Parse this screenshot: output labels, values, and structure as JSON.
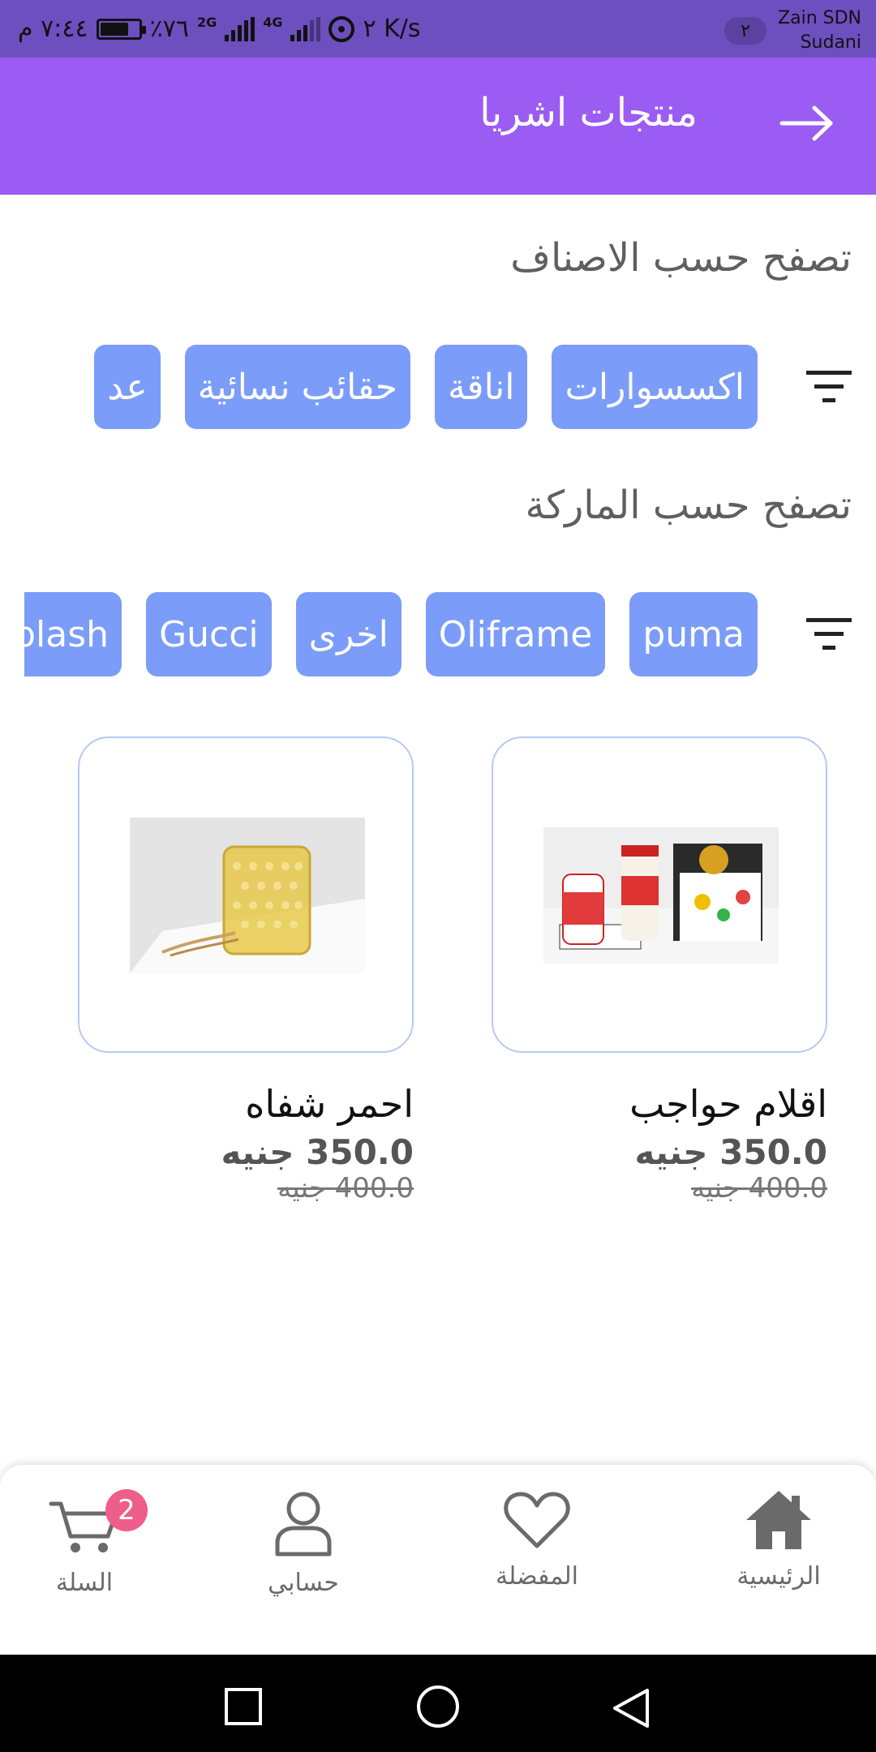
{
  "status_bar": {
    "time": "٧:٤٤ م",
    "battery_text": "٪٧٦",
    "battery_level_percent": 76,
    "net_2g": "2G",
    "net_4g": "4G",
    "speed": "٢ K/s",
    "sim_badge": "٢",
    "carrier_line1": "Zain SDN",
    "carrier_line2": "Sudani"
  },
  "app_bar": {
    "title": "منتجات اشريا",
    "back_icon": "arrow-right-icon"
  },
  "categories": {
    "title": "تصفح حسب الاصناف",
    "filter_icon": "filter-icon",
    "chips": [
      "اكسسوارات",
      "اناقة",
      "حقائب نسائية",
      "عد"
    ]
  },
  "brands": {
    "title": "تصفح حسب الماركة",
    "filter_icon": "filter-icon",
    "chips": [
      "puma",
      "Oliframe",
      "اخرى",
      "Gucci",
      "plash"
    ]
  },
  "products": [
    {
      "name": "اقلام حواجب",
      "price": "350.0 جنيه",
      "old_price": "400.0 جنيه"
    },
    {
      "name": "احمر شفاه",
      "price": "350.0 جنيه",
      "old_price": "400.0 جنيه"
    }
  ],
  "bottom_nav": {
    "home": "الرئيسية",
    "favorites": "المفضلة",
    "account": "حسابي",
    "cart": "السلة",
    "cart_count": "2"
  },
  "colors": {
    "status_bar": "#6e4fbf",
    "app_bar": "#9a5cf2",
    "chip": "#7b9cf8",
    "card_border": "#b9c8f2",
    "badge": "#ef5d8a"
  }
}
